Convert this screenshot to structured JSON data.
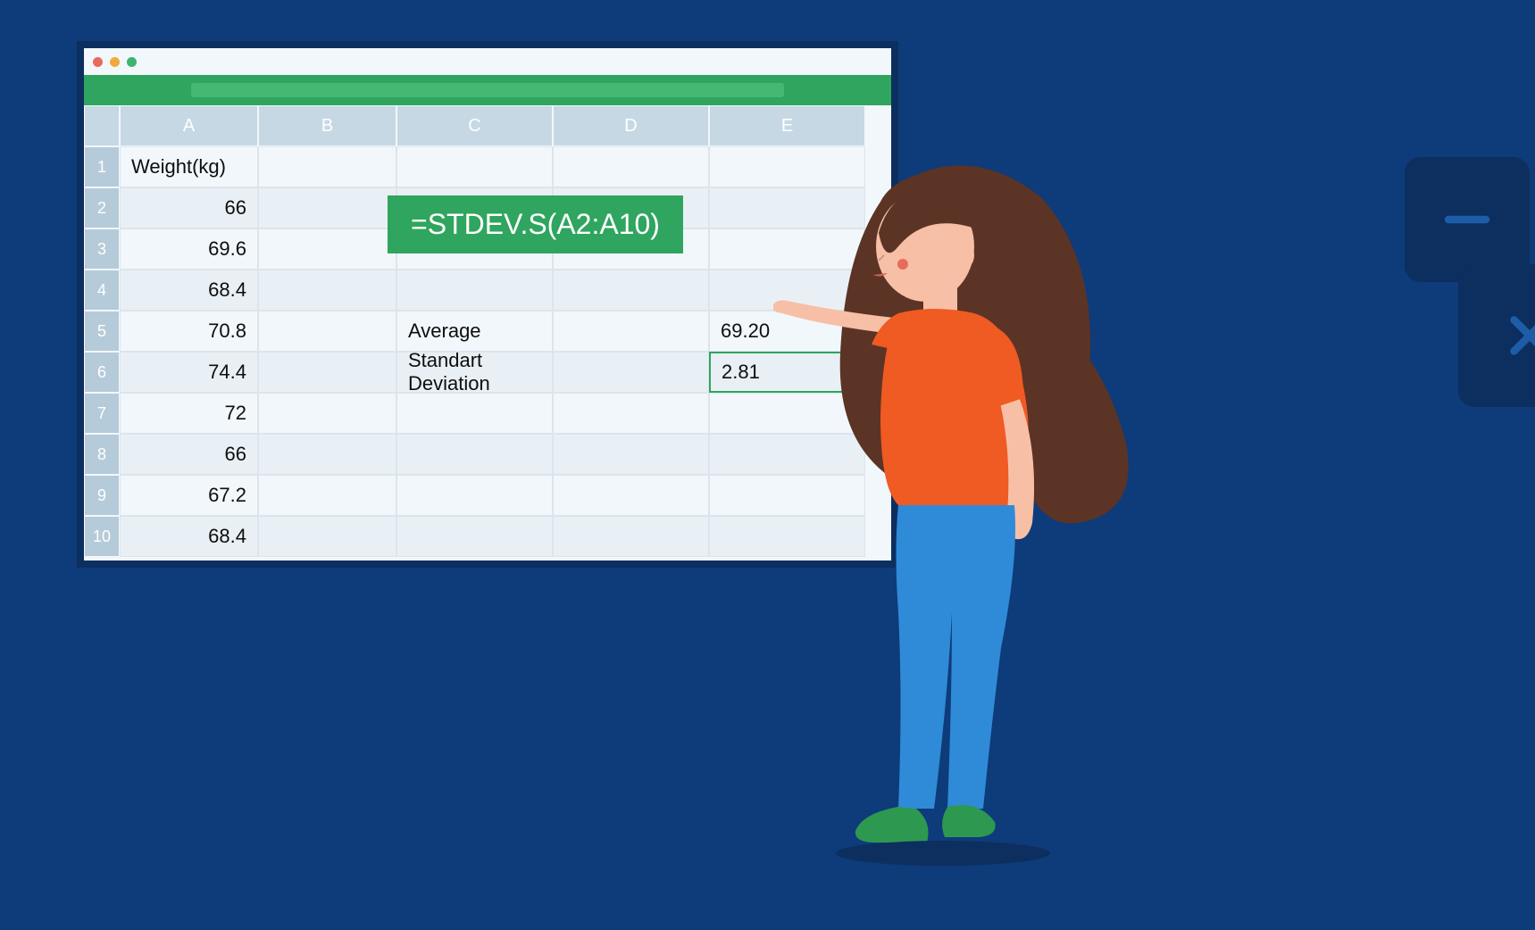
{
  "window": {
    "columns": [
      "A",
      "B",
      "C",
      "D",
      "E"
    ],
    "row_nums": [
      "1",
      "2",
      "3",
      "4",
      "5",
      "6",
      "7",
      "8",
      "9",
      "10"
    ]
  },
  "table": {
    "header": "Weight(kg)",
    "weights": [
      "66",
      "69.6",
      "68.4",
      "70.8",
      "74.4",
      "72",
      "66",
      "67.2",
      "68.4"
    ],
    "labels": {
      "avg": "Average",
      "std": "Standart Deviation"
    },
    "values": {
      "avg": "69.20",
      "std": "2.81"
    }
  },
  "formula": "=STDEV.S(A2:A10)",
  "icons": {
    "minus": "minus",
    "plus": "plus",
    "times": "times",
    "div": "divide"
  }
}
